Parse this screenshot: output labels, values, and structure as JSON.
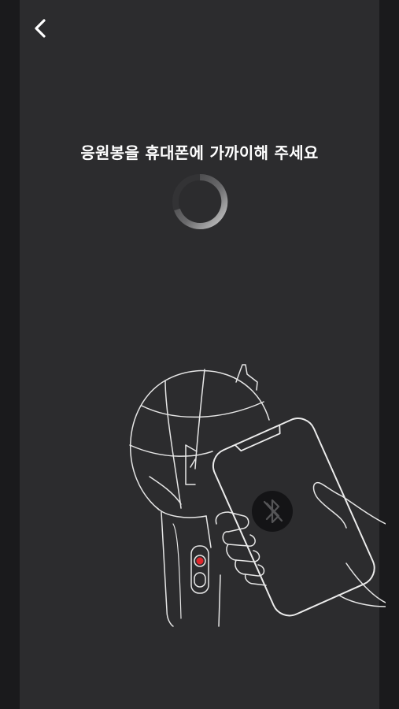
{
  "header": {
    "back_icon": "chevron-left-icon"
  },
  "main": {
    "title": "응원봉을 휴대폰에 가까이해 주세요",
    "status": "loading"
  },
  "illustration": {
    "phone_icon": "bluetooth-off-icon",
    "indicator_color": "#e0262b"
  },
  "colors": {
    "background": "#2c2c2e",
    "side_bars": "#1a1a1c",
    "text": "#ffffff",
    "line_art": "#e8e8e8"
  }
}
